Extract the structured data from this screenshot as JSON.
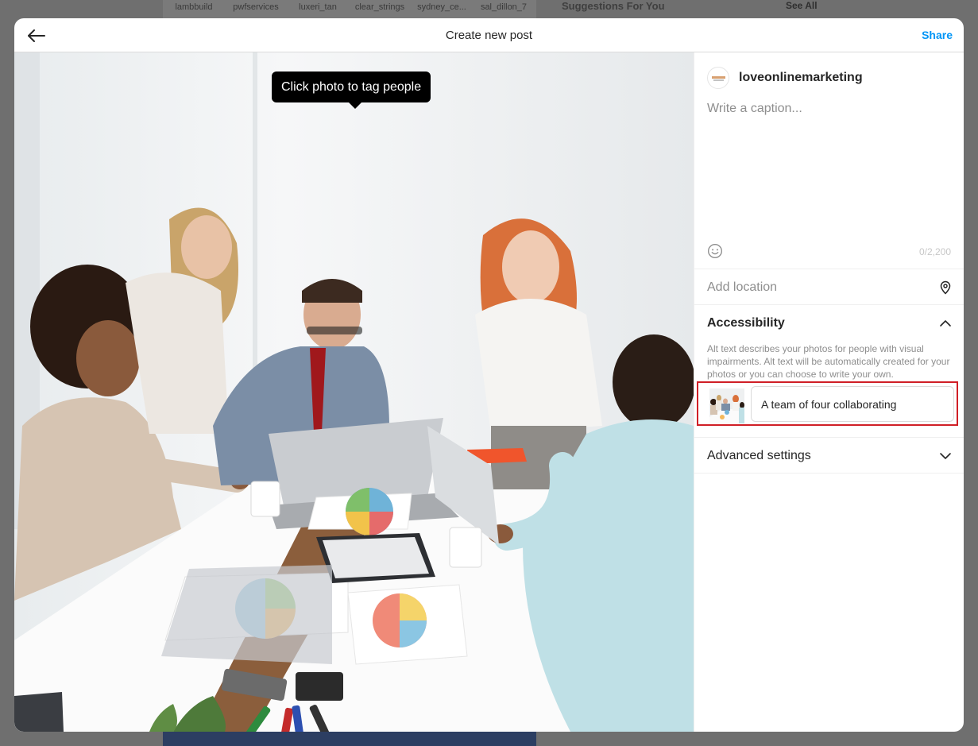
{
  "background": {
    "stories": [
      "lambbuild",
      "pwfservices",
      "luxeri_tan",
      "clear_strings",
      "sydney_ce...",
      "sal_dillon_7"
    ],
    "suggestions_title": "Suggestions For You",
    "see_all": "See All"
  },
  "modal": {
    "title": "Create new post",
    "share_label": "Share",
    "back_icon": "arrow-left-icon"
  },
  "photo": {
    "tooltip": "Click photo to tag people",
    "alt_description": "Four colleagues collaborating at a white meeting table with laptops and printed pie charts"
  },
  "sidebar": {
    "username": "loveonlinemarketing",
    "caption_placeholder": "Write a caption...",
    "caption_value": "",
    "char_count": "0/2,200",
    "location_placeholder": "Add location",
    "accessibility": {
      "title": "Accessibility",
      "description": "Alt text describes your photos for people with visual impairments. Alt text will be automatically created for your photos or you can choose to write your own.",
      "alt_text_value": "A team of four collaborating"
    },
    "advanced_settings": "Advanced settings"
  },
  "colors": {
    "accent": "#0095f6",
    "highlight": "#d01f26",
    "text": "#262626",
    "muted": "#8e8e8e"
  }
}
